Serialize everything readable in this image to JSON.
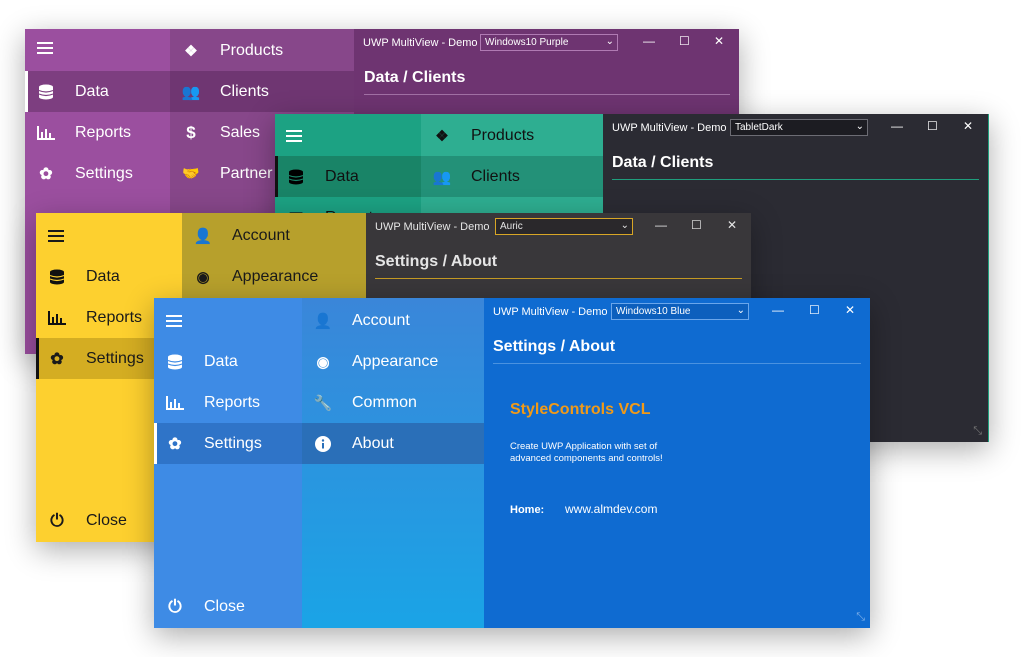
{
  "purple": {
    "title": "UWP MultiView - Demo",
    "theme": "Windows10 Purple",
    "header": "Data / Clients",
    "nav": [
      "Data",
      "Reports",
      "Settings"
    ],
    "sub": [
      "Products",
      "Clients",
      "Sales",
      "Partner"
    ]
  },
  "dark": {
    "title": "UWP MultiView - Demo",
    "theme": "TabletDark",
    "header": "Data / Clients",
    "nav": [
      "Data",
      "Reports"
    ],
    "sub": [
      "Products",
      "Clients"
    ]
  },
  "yellow": {
    "title": "UWP MultiView - Demo",
    "theme": "Auric",
    "header": "Settings / About",
    "nav": [
      "Data",
      "Reports",
      "Settings"
    ],
    "sub": [
      "Account",
      "Appearance"
    ],
    "close": "Close"
  },
  "blue": {
    "title": "UWP MultiView - Demo",
    "theme": "Windows10 Blue",
    "header": "Settings / About",
    "nav": [
      "Data",
      "Reports",
      "Settings"
    ],
    "sub": [
      "Account",
      "Appearance",
      "Common",
      "About"
    ],
    "close": "Close",
    "app_name": "StyleControls VCL",
    "desc_line1": "Create UWP Application with set of",
    "desc_line2": "advanced components and controls!",
    "home_label": "Home:",
    "home_url": "www.almdev.com"
  },
  "colors": {
    "purple_nav": "#8f4592",
    "purple_sub": "#7a3a7d",
    "purple_content": "#6e3471",
    "dark_nav": "#199978",
    "dark_sub": "#25a788",
    "dark_content": "#2b2b33",
    "yellow_nav": "#fdd02f",
    "yellow_sub": "#b7a02c",
    "yellow_content": "#39373a",
    "blue_nav": "#3e8be5",
    "blue_sub": "#2f95e0",
    "blue_content": "#0f6bd1",
    "accent_orange": "#f19a18"
  },
  "icons": [
    "hamburger-icon",
    "database-icon",
    "bar-chart-icon",
    "gear-icon",
    "power-icon",
    "dollar-icon",
    "handshake-icon",
    "cubes-icon",
    "users-icon",
    "user-icon",
    "eye-icon",
    "wrench-icon",
    "info-icon",
    "minimize-icon",
    "maximize-icon",
    "close-icon",
    "chevron-down-icon",
    "resize-grip-icon"
  ]
}
